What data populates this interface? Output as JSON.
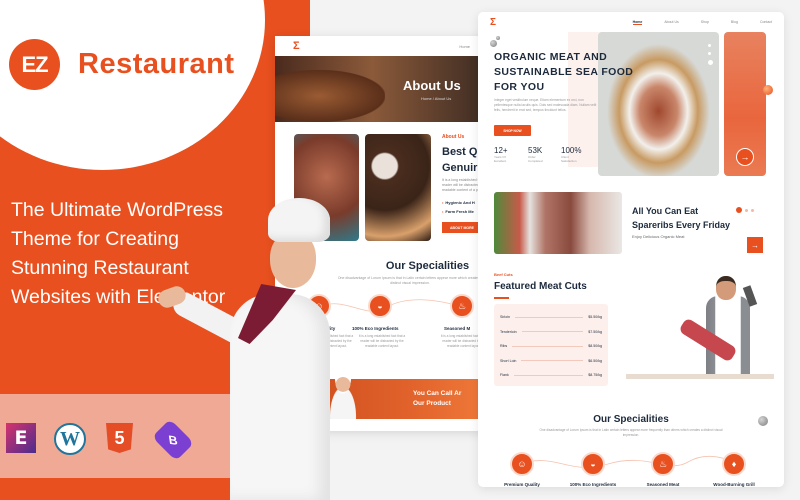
{
  "promo": {
    "logo_text": "EZ",
    "brand_name": "Restaurant",
    "tagline_lines": [
      "The Ultimate WordPress",
      "Theme for Creating",
      "Stunning Restaurant",
      "Websites with Elementor"
    ],
    "tech_icons": [
      {
        "name": "elementor-icon",
        "glyph": "E"
      },
      {
        "name": "wordpress-icon",
        "glyph": "W"
      },
      {
        "name": "html5-icon",
        "glyph": "5"
      },
      {
        "name": "bootstrap-icon",
        "glyph": "B"
      }
    ],
    "colors": {
      "accent": "#e8501f",
      "strip": "#efa994"
    }
  },
  "about_preview": {
    "logo_glyph": "Σ",
    "nav_link": "Home",
    "hero_title": "About Us",
    "hero_breadcrumb": "Home  /  About Us",
    "about_label": "About Us",
    "about_title_lines": [
      "Best Qu",
      "Genuir"
    ],
    "about_text": "It is a long established fact that a reader will be distracted by the readable content of a page when looking at its layout using Lorem Ipsum",
    "bullets": [
      "Hygienic And H",
      "Farm Fresh Me"
    ],
    "about_button": "ABOUT MORE",
    "specialities_title": "Our Specialities",
    "specialities_sub": "One disadvantage of Lorum Ipsum is that in Latin certain letters appear more which creates a distinct visual impression.",
    "specialities": [
      {
        "label": "Quality",
        "icon": "quality-icon",
        "glyph": "☺",
        "desc": "It is a long established fact that a reader will be distracted by the readable content layout."
      },
      {
        "label": "100% Eco Ingredients",
        "icon": "bowl-icon",
        "glyph": "◒",
        "desc": "It is a long established fact that a reader will be distracted by the readable content layout."
      },
      {
        "label": "Seasoned M",
        "icon": "drumstick-icon",
        "glyph": "♨",
        "desc": "It is a long established fact that a reader will be distracted by the readable content layout."
      }
    ],
    "cta_lines": [
      "You Can Call Ar",
      "Our Product"
    ]
  },
  "home_preview": {
    "logo_glyph": "Σ",
    "nav_links": [
      "Home",
      "About Us",
      "Shop",
      "Blog",
      "Contact"
    ],
    "nav_active": "Home",
    "hero_title_lines": [
      "ORGANIC MEAT AND",
      "SUSTAINABLE SEA FOOD",
      "FOR YOU"
    ],
    "hero_text": "Integer eget vestibulum neque. Etiam elementum ex orci, non pellentesque nulla iaculis quis. Duis sed malesuada diam. Nullam velit felis, hendrerit in erat sed, tempus tincidunt tellus.",
    "shop_button": "SHOP NOW",
    "stats": [
      {
        "value": "12+",
        "label": "Years Of Excellent"
      },
      {
        "value": "53K",
        "label": "Order Completed"
      },
      {
        "value": "100%",
        "label": "Client Satisfaction"
      }
    ],
    "side_arrow": "→",
    "promo_title_lines": [
      "All You Can Eat",
      "Spareribs Every Friday"
    ],
    "promo_sub": "Enjoy Delicious Organic Meat",
    "promo_arrow": "→",
    "cuts_label": "Beef Cuts",
    "cuts_title": "Featured Meat Cuts",
    "cuts": [
      {
        "name": "Sirloin",
        "price": "$5.50/kg"
      },
      {
        "name": "Tenderloin",
        "price": "$7.50/kg"
      },
      {
        "name": "Ribs",
        "price": "$8.50/kg"
      },
      {
        "name": "Short Loin",
        "price": "$6.50/kg"
      },
      {
        "name": "Flank",
        "price": "$8.75/kg"
      }
    ],
    "specialities_title": "Our Specialities",
    "specialities_sub": "One disadvantage of Lorum Ipsum is that in Latin certain letters appear more frequently than others which creates a distinct visual impression.",
    "specialities": [
      {
        "label": "Premium Quality",
        "icon": "quality-icon",
        "glyph": "☺"
      },
      {
        "label": "100% Eco Ingredients",
        "icon": "bowl-icon",
        "glyph": "◒"
      },
      {
        "label": "Seasoned Meat",
        "icon": "drumstick-icon",
        "glyph": "♨"
      },
      {
        "label": "Wood-Burning Grill",
        "icon": "flame-icon",
        "glyph": "♦"
      }
    ]
  }
}
